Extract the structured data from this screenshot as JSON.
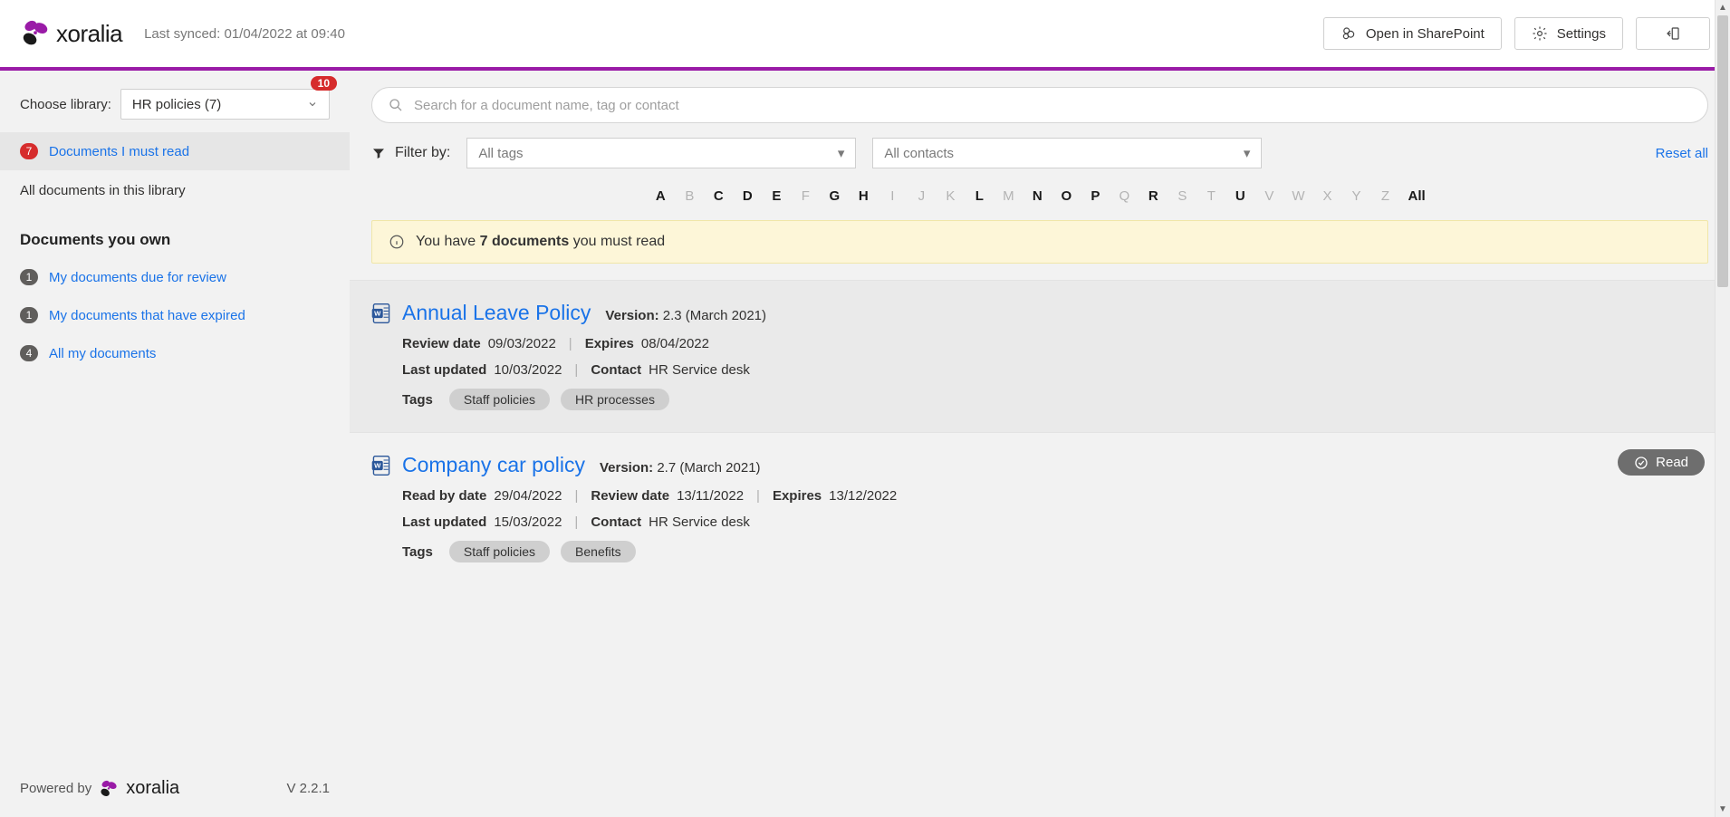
{
  "header": {
    "brand": "xoralia",
    "sync_label": "Last synced: 01/04/2022 at 09:40",
    "open_sp": "Open in SharePoint",
    "settings": "Settings"
  },
  "sidebar": {
    "choose_label": "Choose library:",
    "selected_library": "HR policies (7)",
    "library_badge": "10",
    "must_read": {
      "count": "7",
      "label": "Documents I must read"
    },
    "all_docs": "All documents in this library",
    "own_section": "Documents you own",
    "due_review": {
      "count": "1",
      "label": "My documents due for review"
    },
    "expired": {
      "count": "1",
      "label": "My documents that have expired"
    },
    "all_my": {
      "count": "4",
      "label": "All my documents"
    },
    "powered_by": "Powered by",
    "brand": "xoralia",
    "version": "V 2.2.1"
  },
  "search": {
    "placeholder": "Search for a document name, tag or contact"
  },
  "filters": {
    "label": "Filter by:",
    "tags_placeholder": "All tags",
    "contacts_placeholder": "All contacts",
    "reset": "Reset all"
  },
  "alpha": {
    "letters": [
      "A",
      "B",
      "C",
      "D",
      "E",
      "F",
      "G",
      "H",
      "I",
      "J",
      "K",
      "L",
      "M",
      "N",
      "O",
      "P",
      "Q",
      "R",
      "S",
      "T",
      "U",
      "V",
      "W",
      "X",
      "Y",
      "Z",
      "All"
    ],
    "enabled": [
      "A",
      "C",
      "D",
      "E",
      "G",
      "H",
      "L",
      "N",
      "O",
      "P",
      "R",
      "U",
      "All"
    ]
  },
  "banner": {
    "prefix": "You have ",
    "bold": "7 documents",
    "suffix": " you must read"
  },
  "docs": [
    {
      "title": "Annual Leave Policy",
      "version_label": "Version:",
      "version_value": "2.3 (March 2021)",
      "rows": [
        [
          {
            "label": "Review date",
            "value": "09/03/2022"
          },
          {
            "label": "Expires",
            "value": "08/04/2022"
          }
        ],
        [
          {
            "label": "Last updated",
            "value": "10/03/2022"
          },
          {
            "label": "Contact",
            "value": "HR Service desk"
          }
        ]
      ],
      "tags_label": "Tags",
      "tags": [
        "Staff policies",
        "HR processes"
      ],
      "read": false
    },
    {
      "title": "Company car policy",
      "version_label": "Version:",
      "version_value": "2.7 (March 2021)",
      "rows": [
        [
          {
            "label": "Read by date",
            "value": "29/04/2022"
          },
          {
            "label": "Review date",
            "value": "13/11/2022"
          },
          {
            "label": "Expires",
            "value": "13/12/2022"
          }
        ],
        [
          {
            "label": "Last updated",
            "value": "15/03/2022"
          },
          {
            "label": "Contact",
            "value": "HR Service desk"
          }
        ]
      ],
      "tags_label": "Tags",
      "tags": [
        "Staff policies",
        "Benefits"
      ],
      "read": true,
      "read_label": "Read"
    }
  ]
}
